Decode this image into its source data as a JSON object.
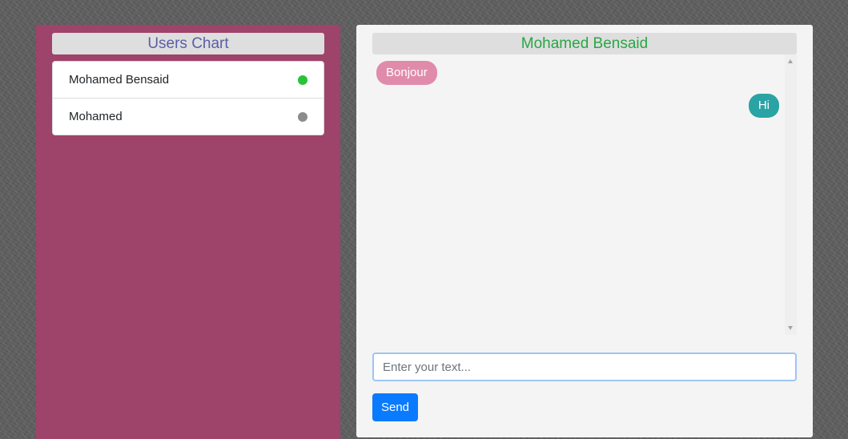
{
  "users_panel": {
    "title": "Users Chart",
    "title_color": "#5b5ea6",
    "background_color": "#9e4369",
    "users": [
      {
        "name": "Mohamed Bensaid",
        "status": "online",
        "status_color": "#27c33a"
      },
      {
        "name": "Mohamed",
        "status": "offline",
        "status_color": "#8c8c8c"
      }
    ]
  },
  "chat_panel": {
    "title": "Mohamed Bensaid",
    "title_color": "#28a745",
    "messages": [
      {
        "text": "Bonjour",
        "direction": "received",
        "color": "#e18bab"
      },
      {
        "text": "Hi",
        "direction": "sent",
        "color": "#2aa3a5"
      }
    ],
    "input": {
      "placeholder": "Enter your text...",
      "value": ""
    },
    "send_button": {
      "label": "Send",
      "color": "#0a7bff"
    }
  }
}
